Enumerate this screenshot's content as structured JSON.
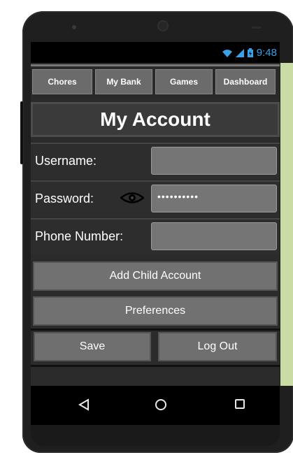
{
  "status_bar": {
    "time": "9:48",
    "icons": [
      "wifi-icon",
      "signal-icon",
      "battery-icon"
    ],
    "accent": "#3aa0e8"
  },
  "tabs": [
    "Chores",
    "My Bank",
    "Games",
    "Dashboard"
  ],
  "title": "My Account",
  "form": {
    "username_label": "Username:",
    "username_value": "",
    "password_label": "Password:",
    "password_value": "••••••••••",
    "phone_label": "Phone Number:",
    "phone_value": ""
  },
  "buttons": {
    "add_child": "Add Child Account",
    "preferences": "Preferences",
    "save": "Save",
    "logout": "Log Out"
  },
  "navigation": {
    "back": "back-icon",
    "home": "home-icon",
    "recents": "recents-icon"
  },
  "colors": {
    "side_strip": "#c9dca6",
    "button": "#717171",
    "background": "#2b2b2b"
  }
}
